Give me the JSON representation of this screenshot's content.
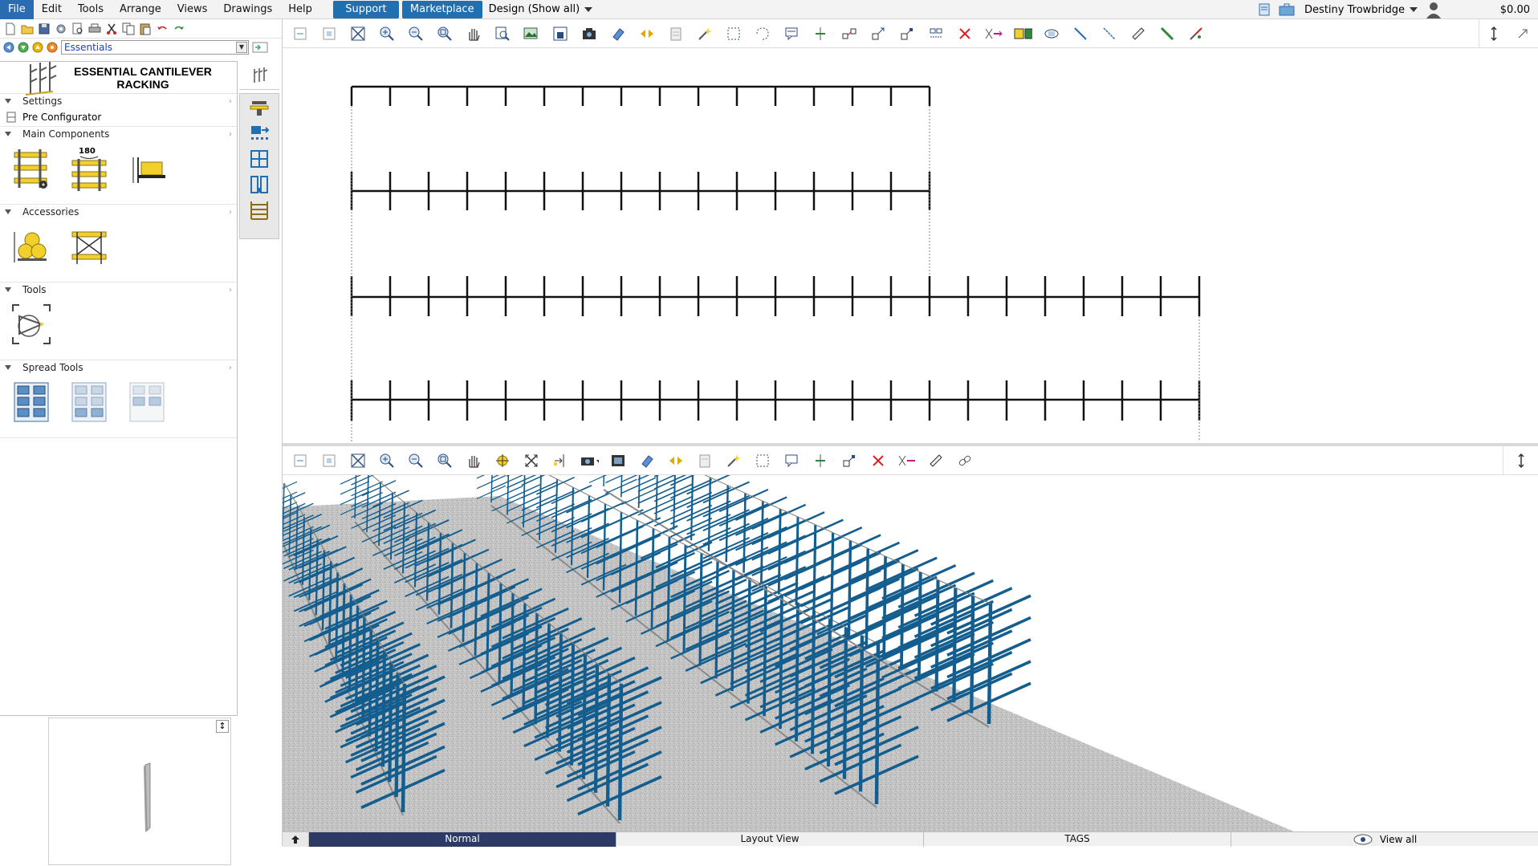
{
  "menubar": {
    "items": [
      "File",
      "Edit",
      "Tools",
      "Arrange",
      "Views",
      "Drawings",
      "Help"
    ],
    "support_label": "Support",
    "marketplace_label": "Marketplace",
    "design_select": "Design (Show all)",
    "user_name": "Destiny Trowbridge",
    "price": "$0.00"
  },
  "library": {
    "selected": "Essentials"
  },
  "catalog": {
    "title_line1": "ESSENTIAL CANTILEVER",
    "title_line2": "RACKING",
    "sections": {
      "settings": "Settings",
      "pre_configurator": "Pre Configurator",
      "main_components": "Main Components",
      "main_components_badge": "180",
      "accessories": "Accessories",
      "tools": "Tools",
      "spread_tools": "Spread Tools"
    }
  },
  "bottom_tabs": {
    "normal": "Normal",
    "layout_view": "Layout View",
    "tags": "TAGS",
    "view_all": "View all"
  },
  "colors": {
    "accent": "#1f6fb2",
    "rack_blue": "#135e8e",
    "rack_yellow": "#f2cf2a",
    "active_tab": "#2d3a66"
  }
}
